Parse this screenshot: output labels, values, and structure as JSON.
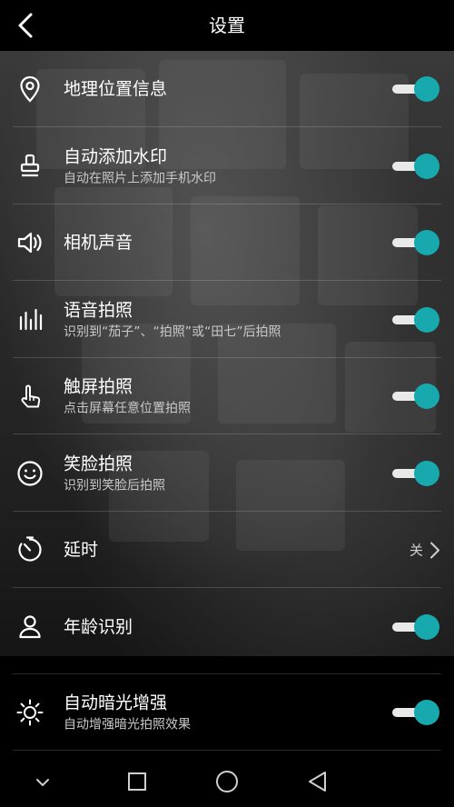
{
  "header": {
    "title": "设置"
  },
  "settings": [
    {
      "label": "地理位置信息",
      "sub": "",
      "control": "toggle",
      "on": true,
      "icon": "location-pin-icon"
    },
    {
      "label": "自动添加水印",
      "sub": "自动在照片上添加手机水印",
      "control": "toggle",
      "on": true,
      "icon": "stamp-icon"
    },
    {
      "label": "相机声音",
      "sub": "",
      "control": "toggle",
      "on": true,
      "icon": "speaker-icon"
    },
    {
      "label": "语音拍照",
      "sub": "识别到“茄子”、“拍照”或“田七”后拍照",
      "control": "toggle",
      "on": true,
      "icon": "voice-bars-icon"
    },
    {
      "label": "触屏拍照",
      "sub": "点击屏幕任意位置拍照",
      "control": "toggle",
      "on": true,
      "icon": "touch-hand-icon"
    },
    {
      "label": "笑脸拍照",
      "sub": "识别到笑脸后拍照",
      "control": "toggle",
      "on": true,
      "icon": "smile-face-icon"
    },
    {
      "label": "延时",
      "sub": "",
      "control": "value",
      "value": "关",
      "icon": "timer-icon"
    },
    {
      "label": "年龄识别",
      "sub": "",
      "control": "toggle",
      "on": true,
      "icon": "person-icon"
    },
    {
      "label": "自动暗光增强",
      "sub": "自动增强暗光拍照效果",
      "control": "toggle",
      "on": true,
      "icon": "brightness-icon"
    }
  ],
  "colors": {
    "accent": "#17a9ad",
    "track": "#e9e9e9",
    "background": "#000000"
  },
  "navbar": {
    "buttons": [
      "chevron-down-icon",
      "recent-apps-icon",
      "home-icon",
      "back-triangle-icon"
    ]
  }
}
